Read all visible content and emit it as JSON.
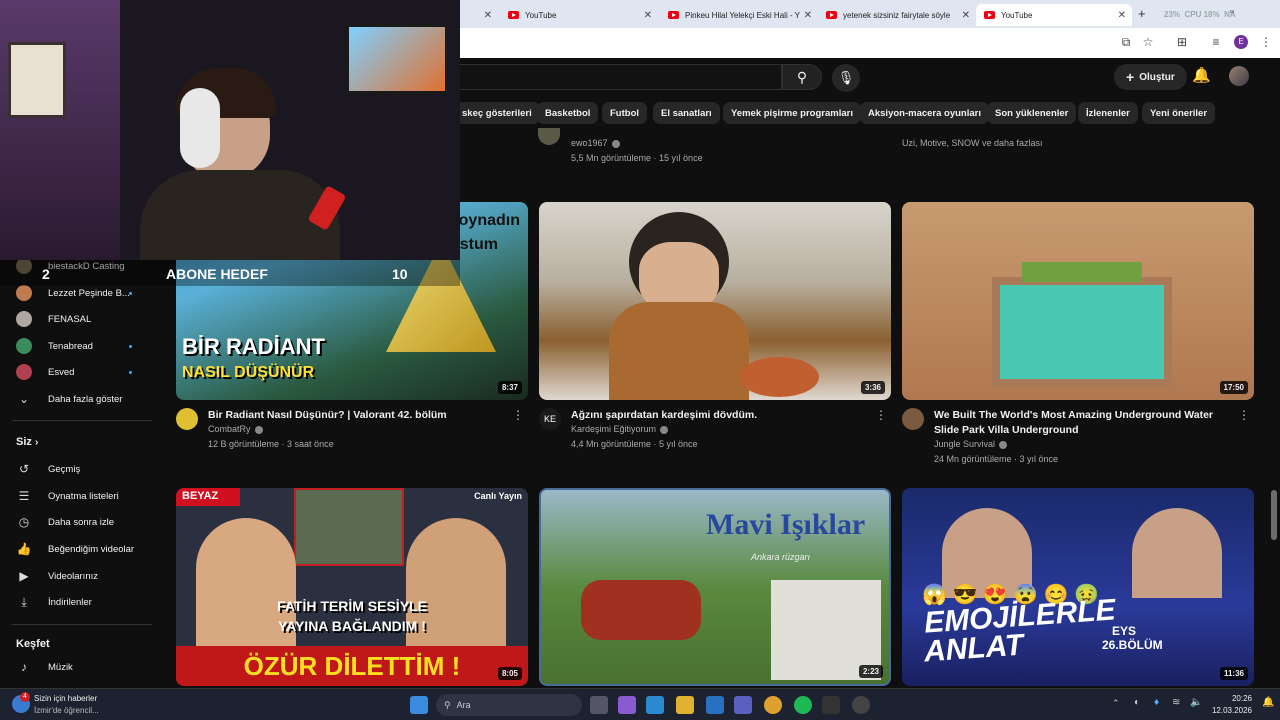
{
  "browser": {
    "tabs": [
      {
        "title": "YouTube"
      },
      {
        "title": "Pinkeu Hilal Yelekçi Eski Hali - Y"
      },
      {
        "title": "yetenek sizsiniz fairytale söyle"
      },
      {
        "title": "YouTube"
      }
    ],
    "status": {
      "cpu": "CPU",
      "cpu_val": "18%",
      "pct": "23%",
      "na": "NA"
    },
    "profile_letter": "E"
  },
  "youtube": {
    "create_label": "Oluştur",
    "chips": [
      "skeç gösterileri",
      "Basketbol",
      "Futbol",
      "El sanatları",
      "Yemek pişirme programları",
      "Aksiyon-macera oyunları",
      "Son yüklenenler",
      "İzlenenler",
      "Yeni öneriler"
    ]
  },
  "overlay": {
    "abone_count": "2",
    "abone_label": "ABONE HEDEF",
    "abone_goal": "10"
  },
  "sidebar": {
    "channels": [
      {
        "name": "biestackD Casting",
        "color": "#7a6a55"
      },
      {
        "name": "Lezzet Peşinde B...",
        "color": "#c07a50"
      },
      {
        "name": "FENASAL",
        "color": "#b0a8a0"
      },
      {
        "name": "Tenabread",
        "color": "#3a8c5c"
      },
      {
        "name": "Esved",
        "color": "#b04050"
      }
    ],
    "show_more": "Daha fazla göster",
    "you_header": "Siz",
    "you_items": [
      {
        "label": "Geçmiş",
        "icon": "history-icon",
        "glyph": "↺"
      },
      {
        "label": "Oynatma listeleri",
        "icon": "playlist-icon",
        "glyph": "☰"
      },
      {
        "label": "Daha sonra izle",
        "icon": "clock-icon",
        "glyph": "◷"
      },
      {
        "label": "Beğendiğim videolar",
        "icon": "like-icon",
        "glyph": "👍"
      },
      {
        "label": "Videolarınız",
        "icon": "your-videos-icon",
        "glyph": "▶"
      },
      {
        "label": "İndirilenler",
        "icon": "download-icon",
        "glyph": "⤓"
      }
    ],
    "explore_header": "Keşfet",
    "explore_items": [
      {
        "label": "Müzik",
        "icon": "music-icon",
        "glyph": "♪"
      }
    ]
  },
  "top_row": [
    {
      "channel": "ewo1967",
      "stats": "5,5 Mn görüntüleme · 15 yıl önce"
    },
    {
      "channel": "Uzi, Motive, SNOW ve daha fazlası",
      "stats": ""
    }
  ],
  "videos_row1": [
    {
      "title": "Bir Radiant Nasıl Düşünür? | Valorant 42. bölüm",
      "channel": "CombatRy",
      "stats": "12 B görüntüleme · 3 saat önce",
      "duration": "8:37",
      "thumb_text1": "BİR RADİANT",
      "thumb_text2": "NASIL DÜŞÜNÜR",
      "thumb_text3": "oynadın",
      "thumb_text4": "stum"
    },
    {
      "title": "Ağzını şapırdatan kardeşimi dövdüm.",
      "channel": "Kardeşimi Eğitiyorum",
      "stats": "4,4 Mn görüntüleme · 5 yıl önce",
      "duration": "3:36"
    },
    {
      "title": "We Built The World's Most Amazing Underground Water Slide Park Villa Underground",
      "channel": "Jungle Survival",
      "stats": "24 Mn görüntüleme · 3 yıl önce",
      "duration": "17:50"
    }
  ],
  "videos_row2": [
    {
      "duration": "8:05",
      "thumb_text1": "FATİH TERİM SESİYLE",
      "thumb_text2": "YAYINA BAĞLANDIM !",
      "thumb_text3": "ÖZÜR DİLETTİM !",
      "badge": "BEYAZ",
      "live": "Canlı Yayın"
    },
    {
      "duration": "2:23",
      "thumb_text1": "Mavi Işıklar",
      "thumb_text2": "Ankara rüzgarı"
    },
    {
      "duration": "11:36",
      "thumb_text1": "EMOJİLERLE",
      "thumb_text2": "ANLAT",
      "thumb_text3": "EYS",
      "thumb_text4": "26.BÖLÜM"
    }
  ],
  "taskbar": {
    "news_title": "Sizin için haberler",
    "news_sub": "İzmir'de öğrencil...",
    "news_badge": "4",
    "search_placeholder": "Ara",
    "time": "20:26",
    "date": "12.03.2026"
  }
}
